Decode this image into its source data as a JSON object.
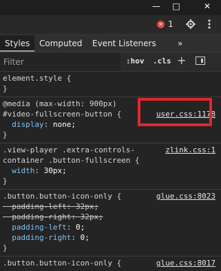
{
  "window": {
    "minimize_label": "—",
    "maximize_label": "□",
    "close_label": "✕"
  },
  "toolbar": {
    "error_icon_glyph": "✕",
    "error_count": "1",
    "settings_icon": "gear-icon",
    "more_icon": "kebab-icon"
  },
  "tabs": {
    "styles": "Styles",
    "computed": "Computed",
    "event_listeners": "Event Listeners",
    "more": "»"
  },
  "filter": {
    "placeholder": "Filter",
    "hov": ":hov",
    "cls": ".cls",
    "plus": "+"
  },
  "rules": [
    {
      "selector_lines": [
        "element.style {"
      ],
      "declarations": [],
      "closing": "}",
      "source": ""
    },
    {
      "selector_lines": [
        "@media (max-width: 900px)",
        "#video-fullscreen-button {"
      ],
      "declarations": [
        {
          "prop": "display",
          "value": "none;"
        }
      ],
      "closing": "}",
      "source": "user.css:1178"
    },
    {
      "selector_lines": [
        ".view-player .extra-controls-",
        "container .button-fullscreen {"
      ],
      "declarations": [
        {
          "prop": "width",
          "value": "30px;"
        }
      ],
      "closing": "}",
      "source": "zlink.css:1"
    },
    {
      "selector_lines": [
        ".button.button-icon-only {"
      ],
      "declarations": [
        {
          "prop": "padding-left",
          "value": "32px;"
        },
        {
          "prop": "padding-right",
          "value": "32px;"
        },
        {
          "prop": "padding-left",
          "value": "0;"
        },
        {
          "prop": "padding-right",
          "value": "0;"
        }
      ],
      "closing": "}",
      "source": "glue.css:8023"
    },
    {
      "selector_lines": [
        ".button.button-icon-only {"
      ],
      "declarations": [],
      "closing": "",
      "source": "glue.css:8017"
    }
  ],
  "colors": {
    "property": "#7ec6f0",
    "highlight_box": "#e3262c",
    "error": "#e0443e"
  }
}
